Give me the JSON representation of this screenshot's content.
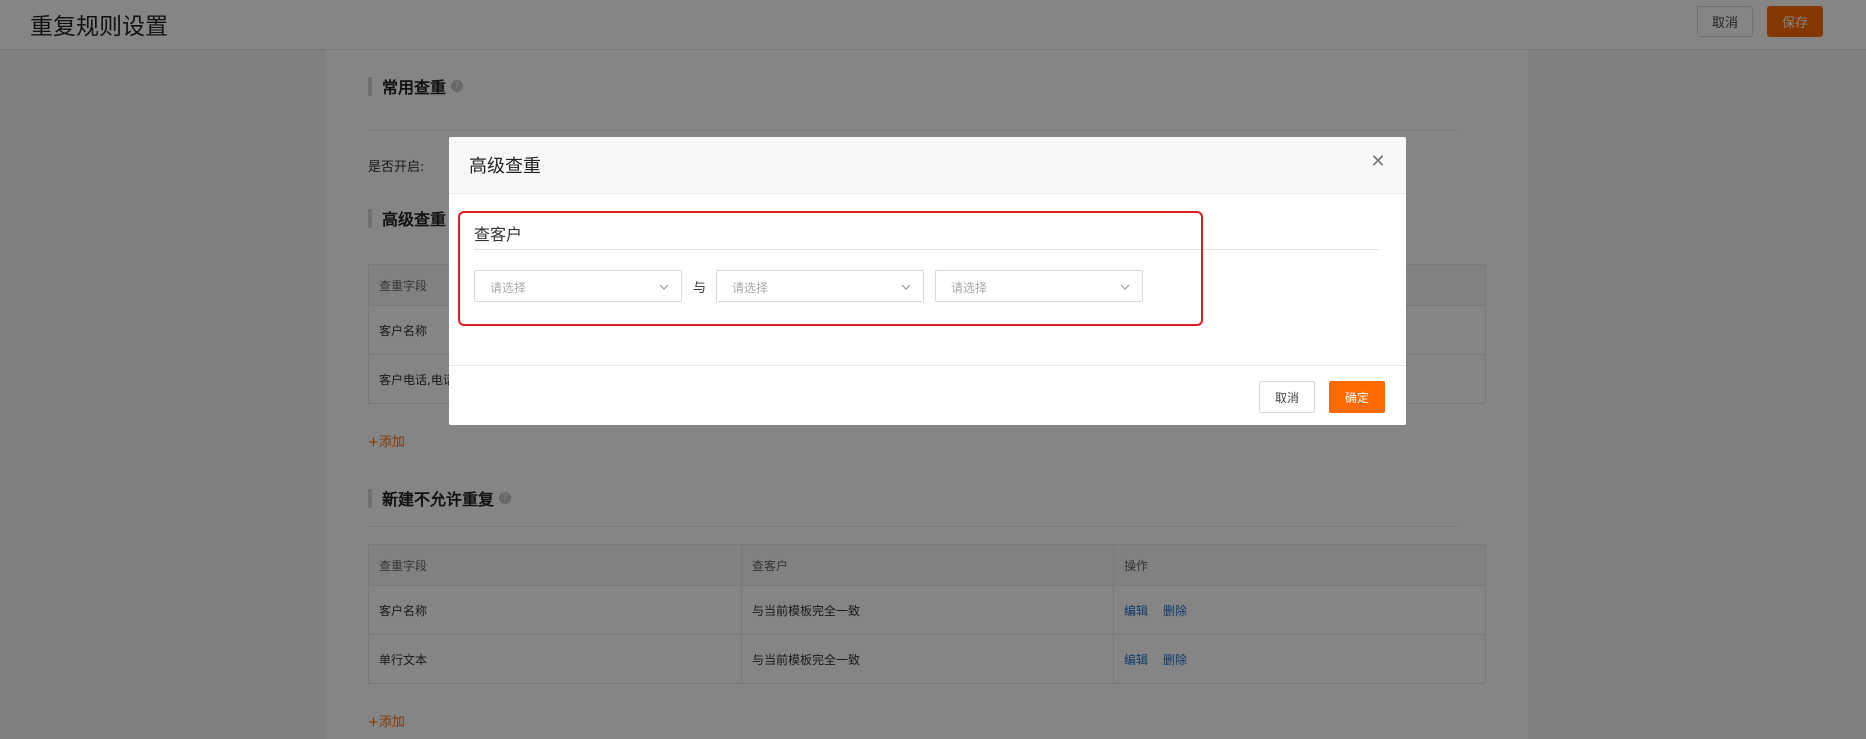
{
  "page": {
    "title": "重复规则设置",
    "cancel_label": "取消",
    "save_label": "保存"
  },
  "sections": {
    "common": {
      "title": "常用查重",
      "enable_label": "是否开启:"
    },
    "advanced": {
      "title": "高级查重",
      "table": {
        "header": [
          "查重字段"
        ],
        "rows": [
          [
            "客户名称"
          ],
          [
            "客户电话,电话"
          ]
        ]
      },
      "add_label": "+添加"
    },
    "no_dup": {
      "title": "新建不允许重复",
      "table": {
        "header": [
          "查重字段",
          "查客户",
          "操作"
        ],
        "rows": [
          [
            "客户名称",
            "与当前模板完全一致"
          ],
          [
            "单行文本",
            "与当前模板完全一致"
          ]
        ],
        "edit_label": "编辑",
        "delete_label": "删除"
      },
      "add_label": "+添加"
    }
  },
  "modal": {
    "title": "高级查重",
    "group_title": "查客户",
    "select_placeholder": "请选择",
    "and_text": "与",
    "cancel_label": "取消",
    "ok_label": "确定"
  },
  "colors": {
    "accent": "#ff6a00",
    "link": "#1f6fd1",
    "highlight": "#e02020"
  }
}
